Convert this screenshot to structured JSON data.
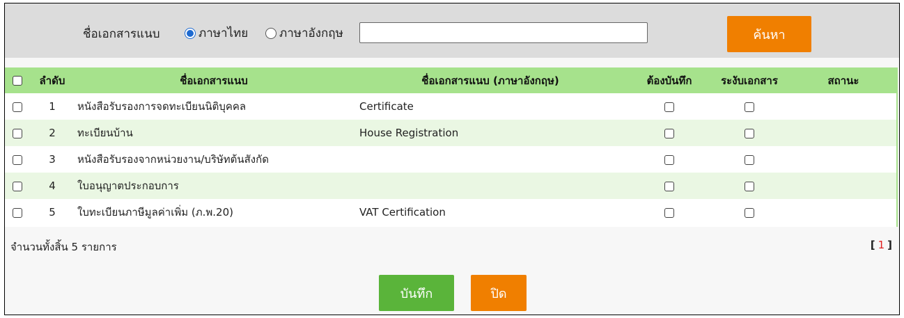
{
  "search": {
    "label": "ชื่อเอกสารแนบ",
    "options": [
      "ภาษาไทย",
      "ภาษาอังกฤษ"
    ],
    "selected": "ภาษาไทย",
    "value": "",
    "button": "ค้นหา"
  },
  "table": {
    "headers": {
      "no": "ลำดับ",
      "name": "ชื่อเอกสารแนบ",
      "name_en": "ชื่อเอกสารแนบ (ภาษาอังกฤษ)",
      "required": "ต้องบันทึก",
      "suspend": "ระงับเอกสาร",
      "status": "สถานะ"
    },
    "rows": [
      {
        "no": "1",
        "name": "หนังสือรับรองการจดทะเบียนนิติบุคคล",
        "name_en": "Certificate"
      },
      {
        "no": "2",
        "name": "ทะเบียนบ้าน",
        "name_en": "House Registration"
      },
      {
        "no": "3",
        "name": "หนังสือรับรองจากหน่วยงาน/บริษัทต้นสังกัด",
        "name_en": ""
      },
      {
        "no": "4",
        "name": "ใบอนุญาตประกอบการ",
        "name_en": ""
      },
      {
        "no": "5",
        "name": "ใบทะเบียนภาษีมูลค่าเพิ่ม (ภ.พ.20)",
        "name_en": "VAT Certification"
      }
    ]
  },
  "footer": {
    "total": "จำนวนทั้งสิ้น 5 รายการ",
    "pager_open": "[",
    "pager_current": "1",
    "pager_close": "]"
  },
  "actions": {
    "save": "บันทึก",
    "close": "ปิด"
  },
  "colors": {
    "accent_orange": "#f07f00",
    "save_green": "#5ab43a",
    "header_green": "#a6e28c",
    "row_alt": "#eaf7e3",
    "radio_blue": "#1e6ad0"
  }
}
